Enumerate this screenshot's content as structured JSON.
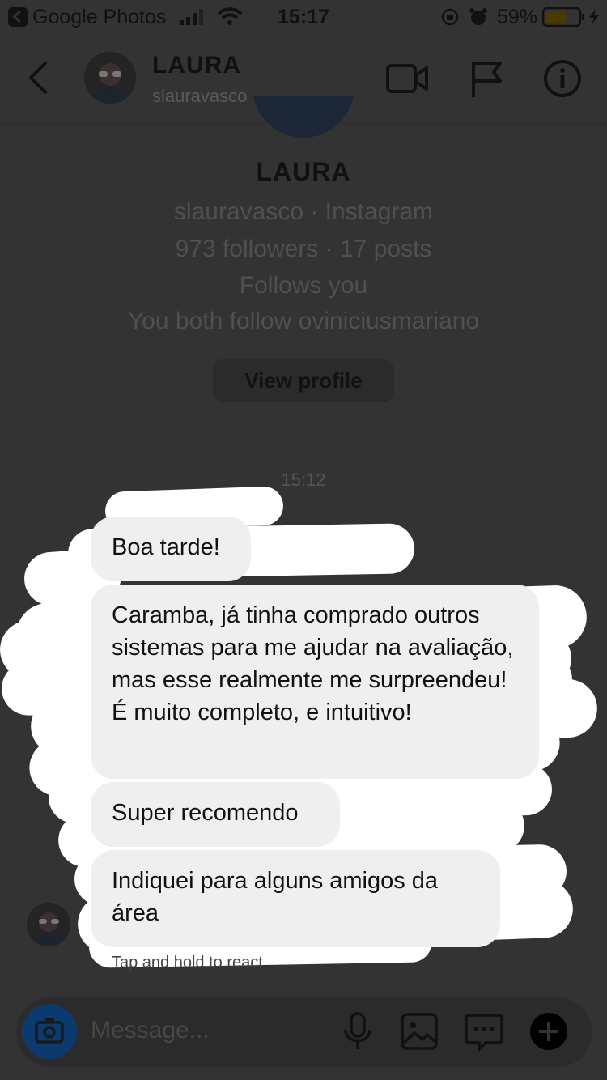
{
  "status_bar": {
    "back_app": "Google Photos",
    "time": "15:17",
    "battery_percent": "59%"
  },
  "header": {
    "title": "LAURA",
    "username": "slauravasco",
    "icons": [
      "back-arrow-icon",
      "video-call-icon",
      "flag-icon",
      "info-icon"
    ]
  },
  "profile": {
    "name": "LAURA",
    "source": "slauravasco · Instagram",
    "stats": "973 followers · 17 posts",
    "follows_you": "Follows you",
    "mutual": "You both follow oviniciusmariano",
    "view_profile_label": "View profile"
  },
  "conversation": {
    "timestamp": "15:12",
    "messages": [
      "Boa tarde!",
      "Caramba, já tinha comprado outros sistemas para me ajudar na avaliação, mas esse realmente me surpreendeu! É muito completo, e intuitivo!",
      "Super recomendo",
      "Indiquei para alguns amigos da área"
    ],
    "hint": "Tap and hold to react"
  },
  "composer": {
    "placeholder": "Message..."
  },
  "colors": {
    "background": "#333333",
    "bubble": "#efefef",
    "camera_button": "#0c3a6e"
  }
}
